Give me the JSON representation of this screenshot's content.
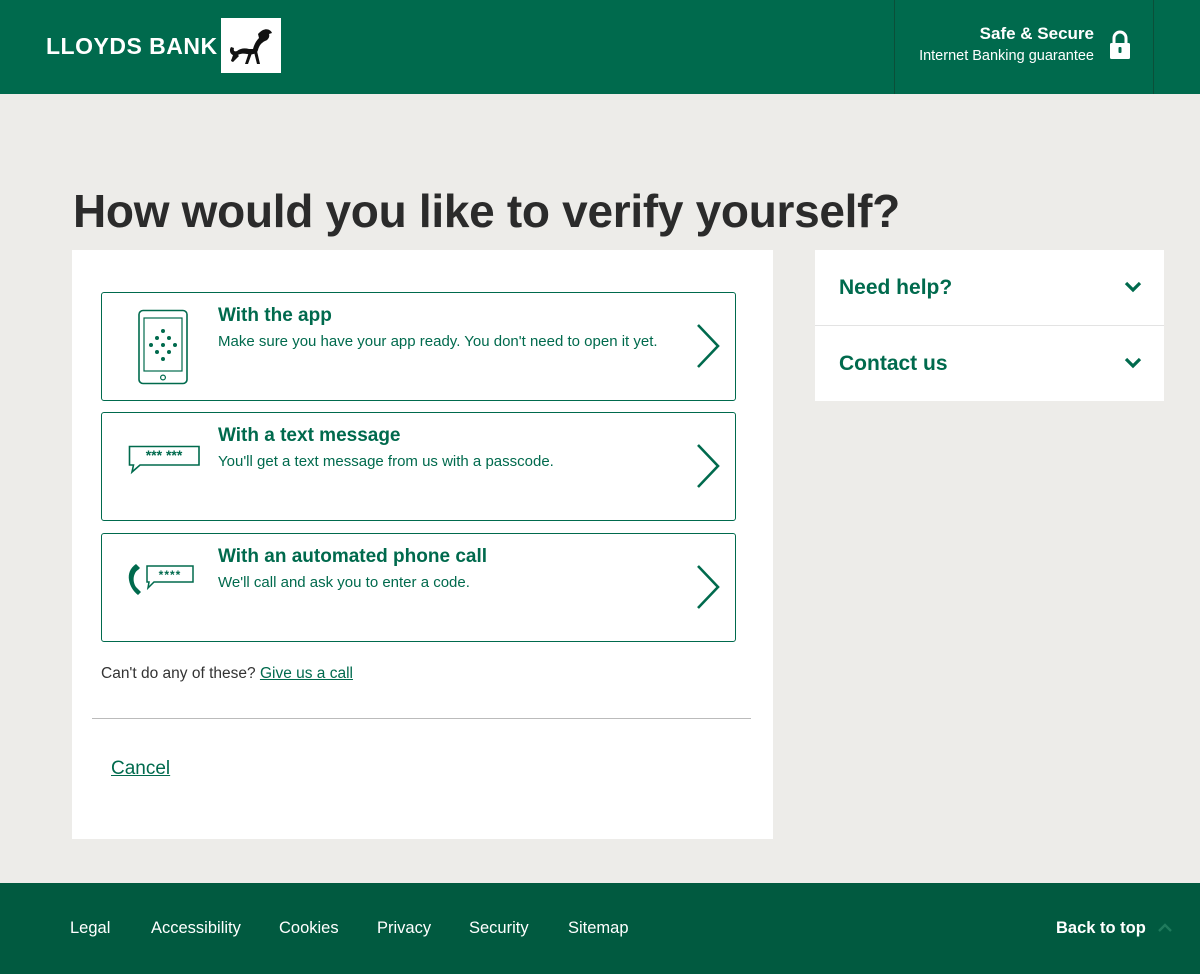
{
  "header": {
    "brand": "LLOYDS BANK",
    "secure_title": "Safe & Secure",
    "secure_subtitle": "Internet Banking guarantee"
  },
  "page_title": "How would you like to verify yourself?",
  "options": [
    {
      "title": "With the app",
      "description": "Make sure you have your app ready. You don't need to open it yet.",
      "icon": "phone-app-icon"
    },
    {
      "title": "With a text message",
      "description": "You'll get a text message from us with a passcode.",
      "icon": "text-message-icon"
    },
    {
      "title": "With an automated phone call",
      "description": "We'll call and ask you to enter a code.",
      "icon": "phone-call-icon"
    }
  ],
  "alternative": {
    "prefix": "Can't do any of these?",
    "link": "Give us a call"
  },
  "cancel_label": "Cancel",
  "help_panel": [
    {
      "label": "Need help?"
    },
    {
      "label": "Contact us"
    }
  ],
  "footer": {
    "links": [
      "Legal",
      "Accessibility",
      "Cookies",
      "Privacy",
      "Security",
      "Sitemap"
    ],
    "back_to_top": "Back to top"
  },
  "colors": {
    "brand_green": "#006a4d",
    "footer_green": "#015a40",
    "page_bg": "#edece9"
  }
}
